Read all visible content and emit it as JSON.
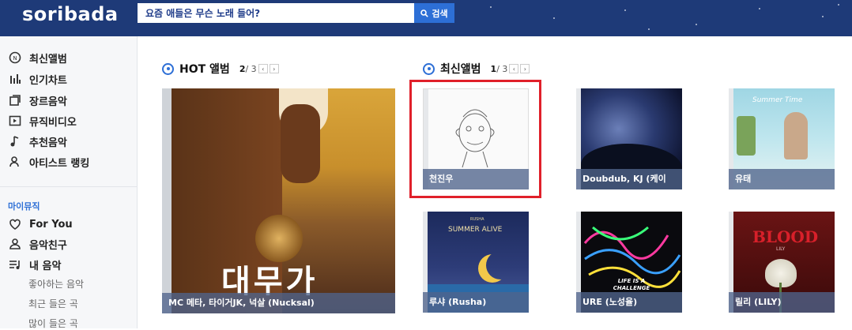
{
  "header": {
    "logo": "soribada",
    "search_placeholder": "요즘 애들은 무슨 노래 들어?",
    "search_button": "검색"
  },
  "sidebar": {
    "items": [
      {
        "label": "최신앨범",
        "icon": "new-icon"
      },
      {
        "label": "인기차트",
        "icon": "chart-icon"
      },
      {
        "label": "장르음악",
        "icon": "genre-icon"
      },
      {
        "label": "뮤직비디오",
        "icon": "video-icon"
      },
      {
        "label": "추천음악",
        "icon": "music-note-icon"
      },
      {
        "label": "아티스트 랭킹",
        "icon": "artist-icon"
      }
    ],
    "my_music_title": "마이뮤직",
    "my_items": [
      {
        "label": "For You",
        "icon": "heart-icon"
      },
      {
        "label": "음악친구",
        "icon": "friends-icon"
      },
      {
        "label": "내 음악",
        "icon": "playlist-icon"
      }
    ],
    "sub_items": [
      "좋아하는 음악",
      "최근 들은 곡",
      "많이 들은 곡"
    ]
  },
  "hot": {
    "title": "HOT 앨범",
    "page_current": "2",
    "page_total": "/ 3",
    "prev": "‹",
    "next": "›",
    "album": {
      "caption": "MC 메타, 타이거JK, 넉살 (Nucksal)",
      "cover_text": "대무가"
    }
  },
  "latest": {
    "title": "최신앨범",
    "page_current": "1",
    "page_total": "/ 3",
    "prev": "‹",
    "next": "›",
    "albums": [
      {
        "caption": "천진우"
      },
      {
        "caption": "Doubdub, KJ (케이"
      },
      {
        "caption": "유태",
        "cover_text": "Summer Time"
      },
      {
        "caption": "루샤 (Rusha)",
        "cover_text": "SUMMER ALIVE",
        "cover_small": "RUSHA"
      },
      {
        "caption": "URE (노성율)",
        "cover_text": "LIFE IS A CHALLENGE"
      },
      {
        "caption": "릴리 (LILY)",
        "cover_text": "BLOOD",
        "cover_small": "LILY"
      }
    ]
  },
  "colors": {
    "header_bg": "#1e3a78",
    "accent": "#2d6fd6",
    "highlight": "#e0202a"
  }
}
